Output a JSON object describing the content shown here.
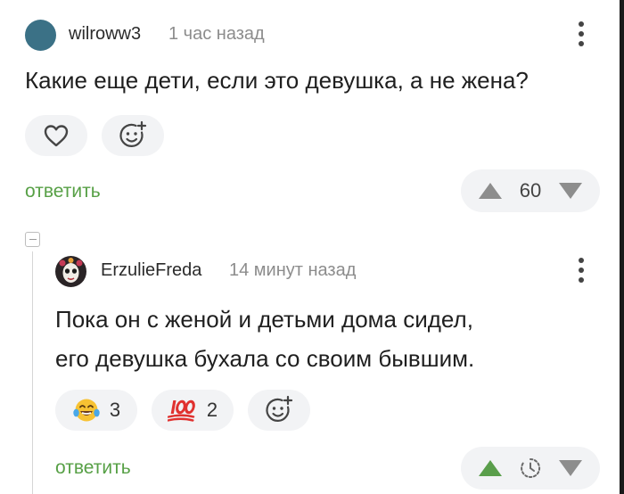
{
  "comment": {
    "author": "wilroww3",
    "time": "1 час назад",
    "text": "Какие еще дети, если это девушка, а не жена?",
    "reply_label": "ответить",
    "rating": "60"
  },
  "reply": {
    "author": "ErzulieFreda",
    "time": "14 минут назад",
    "text_line1": "Пока он с женой и детьми дома сидел,",
    "text_line2": "его девушка бухала со своим бывшим.",
    "reactions": [
      {
        "icon": "laughing-tears-emoji",
        "count": "3"
      },
      {
        "icon": "hundred-points-emoji",
        "count": "2"
      }
    ],
    "reply_label": "ответить"
  },
  "colors": {
    "accent_green": "#57a046",
    "upvote_active": "#5a9e4b",
    "vote_gray": "#8d8d8d",
    "chip_bg": "#f2f3f5"
  },
  "icons": [
    "heart-icon",
    "add-reaction-icon",
    "more-vert-icon",
    "upvote-icon",
    "downvote-icon",
    "timer-icon",
    "collapse-icon"
  ]
}
